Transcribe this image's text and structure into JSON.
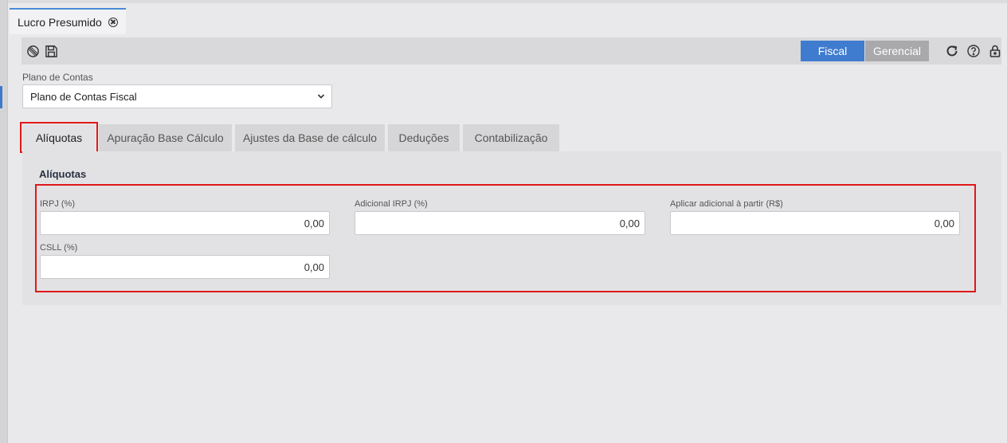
{
  "document_tab": {
    "title": "Lucro Presumido"
  },
  "toolbar": {
    "left_icons": [
      "cancel-icon",
      "save-icon"
    ],
    "toggle": {
      "fiscal": "Fiscal",
      "gerencial": "Gerencial",
      "active": "Fiscal"
    },
    "right_icons": [
      "refresh-icon",
      "help-icon",
      "lock-icon"
    ],
    "accent_color": "#3f7ccf"
  },
  "plano": {
    "label": "Plano de Contas",
    "selected": "Plano de Contas Fiscal"
  },
  "tabs": [
    {
      "label": "Alíquotas",
      "active": true
    },
    {
      "label": "Apuração Base Cálculo",
      "active": false
    },
    {
      "label": "Ajustes da Base de cálculo",
      "active": false
    },
    {
      "label": "Deduções",
      "active": false
    },
    {
      "label": "Contabilização",
      "active": false
    }
  ],
  "panel": {
    "title": "Alíquotas",
    "fields": {
      "irpj": {
        "label": "IRPJ (%)",
        "value": "0,00"
      },
      "adicional_irpj": {
        "label": "Adicional IRPJ (%)",
        "value": "0,00"
      },
      "aplicar_adicional": {
        "label": "Aplicar adicional à partir (R$)",
        "value": "0,00"
      },
      "csll": {
        "label": "CSLL (%)",
        "value": "0,00"
      }
    }
  },
  "highlight_color": "#e01818"
}
